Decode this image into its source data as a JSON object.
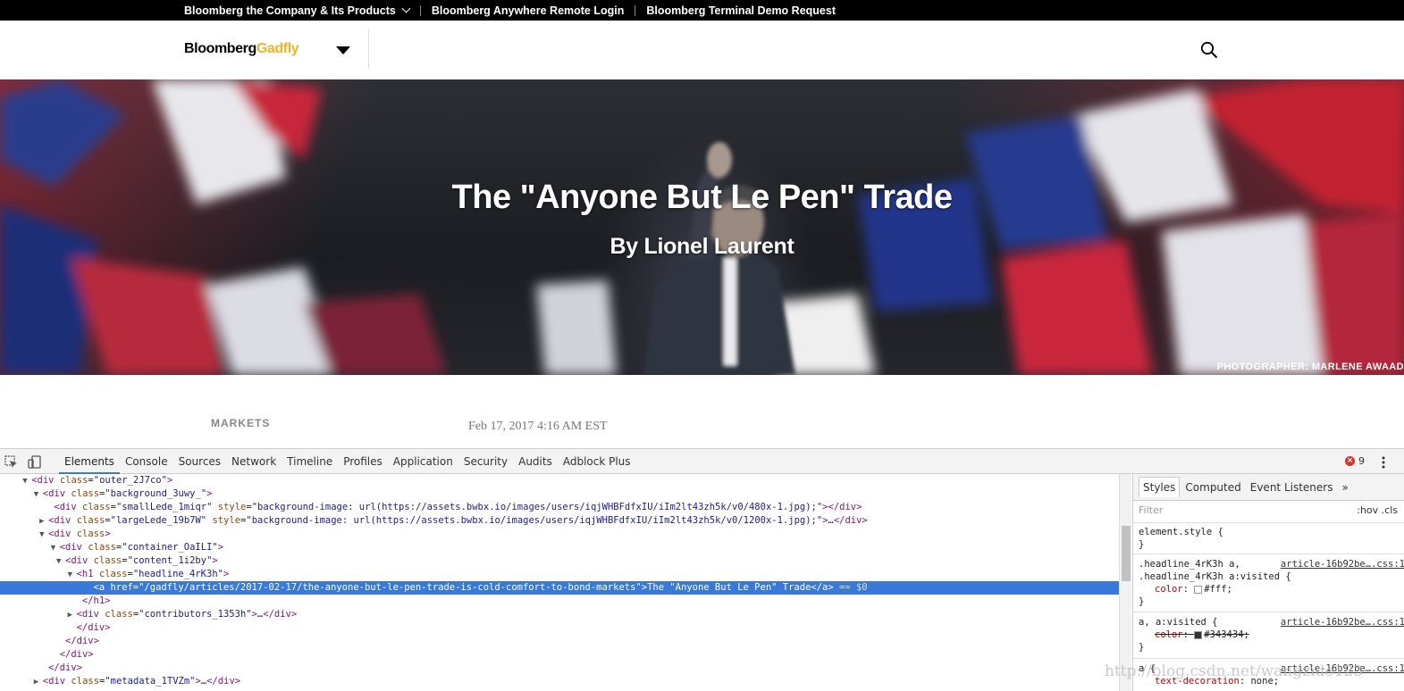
{
  "topbar": {
    "links": [
      {
        "label": "Bloomberg the Company & Its Products"
      },
      {
        "label": "Bloomberg Anywhere Remote Login"
      },
      {
        "label": "Bloomberg Terminal Demo Request"
      }
    ]
  },
  "header": {
    "logo_main": "Bloomberg",
    "logo_accent": "Gadfly",
    "logo_accent_color": "#f0b41c"
  },
  "hero": {
    "title": "The \"Anyone But Le Pen\" Trade",
    "byline": "By Lionel Laurent",
    "credit": "PHOTOGRAPHER: MARLENE AWAAD"
  },
  "meta": {
    "section": "MARKETS",
    "date": "Feb 17, 2017 4:16 AM EST"
  },
  "devtools": {
    "tabs": [
      "Elements",
      "Console",
      "Sources",
      "Network",
      "Timeline",
      "Profiles",
      "Application",
      "Security",
      "Audits",
      "Adblock Plus"
    ],
    "active_tab": "Elements",
    "error_count": "9",
    "dom_lines": [
      {
        "indent": 4,
        "tri": "▼",
        "html": "<span class=\"t\">&lt;div</span> <span class=\"a\">class</span>=<span class=\"v\">\"outer_2J7co\"</span><span class=\"t\">&gt;</span>"
      },
      {
        "indent": 6,
        "tri": "▼",
        "html": "<span class=\"t\">&lt;div</span> <span class=\"a\">class</span>=<span class=\"v\">\"background_3uwy_\"</span><span class=\"t\">&gt;</span>"
      },
      {
        "indent": 8,
        "tri": "",
        "html": "<span class=\"t\">&lt;div</span> <span class=\"a\">class</span>=<span class=\"v\">\"smallLede_1miqr\"</span> <span class=\"a\">style</span>=<span class=\"v\">\"background-image: url(https://assets.bwbx.io/images/users/iqjWHBFdfxIU/iIm2lt43zh5k/v0/480x-1.jpg);\"</span><span class=\"t\">&gt;&lt;/div&gt;</span>"
      },
      {
        "indent": 7,
        "tri": "▶",
        "html": "<span class=\"t\">&lt;div</span> <span class=\"a\">class</span>=<span class=\"v\">\"largeLede_19b7W\"</span> <span class=\"a\">style</span>=<span class=\"v\">\"background-image: url(https://assets.bwbx.io/images/users/iqjWHBFdfxIU/iIm2lt43zh5k/v0/1200x-1.jpg);\"</span><span class=\"t\">&gt;</span>…<span class=\"t\">&lt;/div&gt;</span>"
      },
      {
        "indent": 7,
        "tri": "▼",
        "html": "<span class=\"t\">&lt;div</span> <span class=\"a\">class</span><span class=\"t\">&gt;</span>"
      },
      {
        "indent": 9,
        "tri": "▼",
        "html": "<span class=\"t\">&lt;div</span> <span class=\"a\">class</span>=<span class=\"v\">\"container_OaILI\"</span><span class=\"t\">&gt;</span>"
      },
      {
        "indent": 10,
        "tri": "▼",
        "html": "<span class=\"t\">&lt;div</span> <span class=\"a\">class</span>=<span class=\"v\">\"content_1i2by\"</span><span class=\"t\">&gt;</span>"
      },
      {
        "indent": 12,
        "tri": "▼",
        "html": "<span class=\"t\">&lt;h1</span> <span class=\"a\">class</span>=<span class=\"v\">\"headline_4rK3h\"</span><span class=\"t\">&gt;</span>"
      },
      {
        "indent": 15,
        "tri": "",
        "selected": true,
        "html": "<span class=\"t\">&lt;a</span> <span class=\"a\">href</span>=<span class=\"v\">\"/gadfly/articles/2017-02-17/the-anyone-but-le-pen-trade-is-cold-comfort-to-bond-markets\"</span><span class=\"t\">&gt;</span>The \"Anyone But Le Pen\" Trade<span class=\"t\">&lt;/a&gt;</span> <span class=\"dollar\">== $0</span>"
      },
      {
        "indent": 13,
        "tri": "",
        "html": "<span class=\"t\">&lt;/h1&gt;</span>"
      },
      {
        "indent": 12,
        "tri": "▶",
        "html": "<span class=\"t\">&lt;div</span> <span class=\"a\">class</span>=<span class=\"v\">\"contributors_1353h\"</span><span class=\"t\">&gt;</span>…<span class=\"t\">&lt;/div&gt;</span>"
      },
      {
        "indent": 12,
        "tri": "",
        "html": "<span class=\"t\">&lt;/div&gt;</span>"
      },
      {
        "indent": 10,
        "tri": "",
        "html": "<span class=\"t\">&lt;/div&gt;</span>"
      },
      {
        "indent": 9,
        "tri": "",
        "html": "<span class=\"t\">&lt;/div&gt;</span>"
      },
      {
        "indent": 7,
        "tri": "",
        "html": "<span class=\"t\">&lt;/div&gt;</span>"
      },
      {
        "indent": 6,
        "tri": "▶",
        "html": "<span class=\"t\">&lt;div</span> <span class=\"a\">class</span>=<span class=\"v\">\"metadata_1TVZm\"</span><span class=\"t\">&gt;</span>…<span class=\"t\">&lt;/div&gt;</span>"
      }
    ],
    "styles": {
      "tabs": [
        "Styles",
        "Computed",
        "Event Listeners"
      ],
      "more": "»",
      "filter_placeholder": "Filter",
      "filter_tools": ":hov  .cls",
      "element_style": "element.style {",
      "close_brace": "}",
      "rule1_sel1": ".headline_4rK3h a,",
      "rule1_sel2": ".headline_4rK3h a:visited {",
      "rule1_src": "article-16b92be….css:1",
      "rule1_prop": "color",
      "rule1_val": "#fff;",
      "rule1_swatch": "#ffffff",
      "rule2_sel": "a, a:visited {",
      "rule2_src": "article-16b92be….css:1",
      "rule2_prop": "color",
      "rule2_val": "#343434;",
      "rule2_swatch": "#343434",
      "rule3_sel": "a {",
      "rule3_src": "article-16b92be….css:1",
      "rule3_prop": "text-decoration",
      "rule3_val": "none;"
    }
  },
  "watermark": "http://blog.csdn.net/wangzido123"
}
